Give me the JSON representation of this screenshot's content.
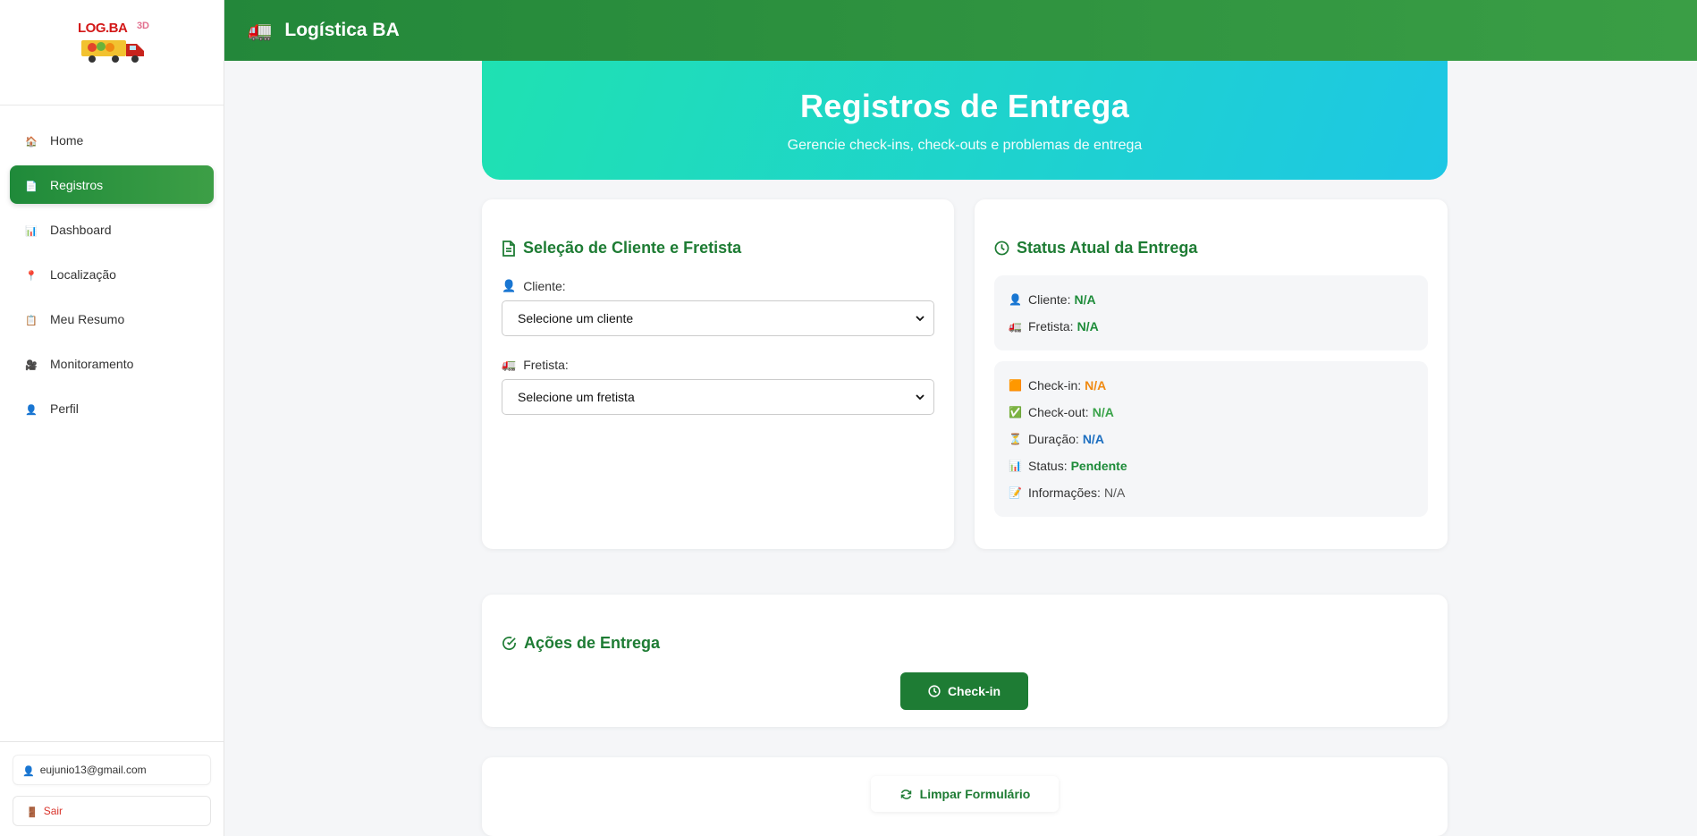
{
  "app": {
    "title": "Logística BA",
    "icon": "truck-icon",
    "logo_text": "LOG.BA",
    "logo_badge": "3D"
  },
  "sidebar": {
    "items": [
      {
        "label": "Home",
        "icon": "🏠",
        "active": false
      },
      {
        "label": "Registros",
        "icon": "📄",
        "active": true
      },
      {
        "label": "Dashboard",
        "icon": "📊",
        "active": false
      },
      {
        "label": "Localização",
        "icon": "📍",
        "active": false
      },
      {
        "label": "Meu Resumo",
        "icon": "📋",
        "active": false
      },
      {
        "label": "Monitoramento",
        "icon": "🎥",
        "active": false
      },
      {
        "label": "Perfil",
        "icon": "👤",
        "active": false
      }
    ],
    "user_email": "eujunio13@gmail.com",
    "logout_label": "Sair"
  },
  "hero": {
    "title": "Registros de Entrega",
    "subtitle": "Gerencie check-ins, check-outs e problemas de entrega"
  },
  "selection": {
    "title": "Seleção de Cliente e Fretista",
    "client_label": "Cliente:",
    "client_value": "Selecione um cliente",
    "driver_label": "Fretista:",
    "driver_value": "Selecione um fretista"
  },
  "status": {
    "title": "Status Atual da Entrega",
    "client_label": "Cliente:",
    "client_value": "N/A",
    "driver_label": "Fretista:",
    "driver_value": "N/A",
    "checkin_label": "Check-in:",
    "checkin_value": "N/A",
    "checkout_label": "Check-out:",
    "checkout_value": "N/A",
    "duration_label": "Duração:",
    "duration_value": "N/A",
    "status_label": "Status:",
    "status_value": "Pendente",
    "info_label": "Informações:",
    "info_value": "N/A"
  },
  "actions": {
    "title": "Ações de Entrega",
    "checkin_button": "Check-in"
  },
  "reset": {
    "label": "Limpar Formulário"
  },
  "colors": {
    "primary": "#1e7c34",
    "hero_start": "#1fe1b2",
    "hero_end": "#1ec7e4",
    "danger": "#d9342b"
  }
}
